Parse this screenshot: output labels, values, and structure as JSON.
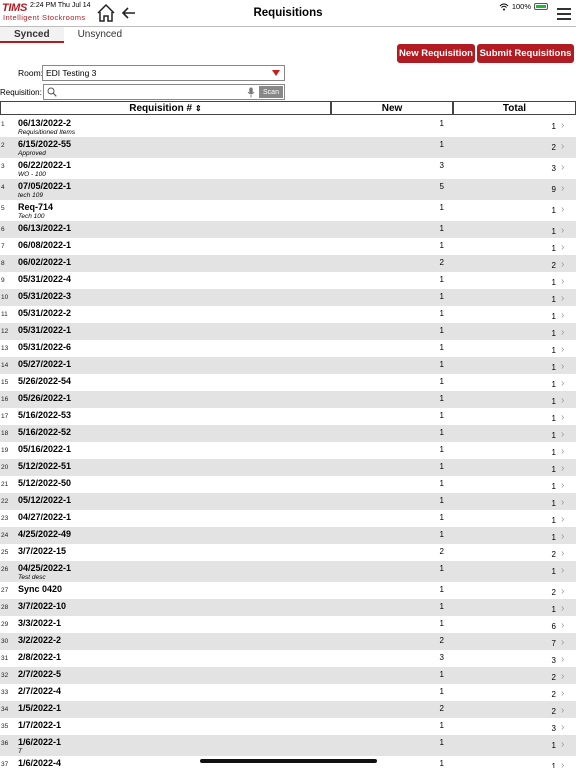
{
  "status": {
    "time": "2:24 PM  Thu Jul 14",
    "battery": "100%"
  },
  "logo": {
    "brand": "TIMS",
    "brand_alt": "AutoStock",
    "subtitle": "Intelligent Stockrooms"
  },
  "header": {
    "title": "Requisitions"
  },
  "tabs": [
    {
      "label": "Synced"
    },
    {
      "label": "Unsynced"
    }
  ],
  "actions": {
    "new_label": "New Requisition",
    "submit_label": "Submit Requisitions"
  },
  "room": {
    "label": "Room:",
    "value": "EDI Testing 3"
  },
  "requisition_search": {
    "label": "Requisition:",
    "placeholder": "",
    "scan_label": "Scan"
  },
  "table": {
    "headers": {
      "req": "Requisition #",
      "new": "New",
      "total": "Total"
    },
    "rows": [
      {
        "num": "1",
        "req": "06/13/2022-2",
        "desc": "Requisitioned Items",
        "new": "1",
        "total": "1"
      },
      {
        "num": "2",
        "req": "6/15/2022-55",
        "desc": "Approved",
        "new": "1",
        "total": "2"
      },
      {
        "num": "3",
        "req": "06/22/2022-1",
        "desc": "WO - 100",
        "new": "3",
        "total": "3"
      },
      {
        "num": "4",
        "req": "07/05/2022-1",
        "desc": "tech 109",
        "new": "5",
        "total": "9"
      },
      {
        "num": "5",
        "req": "Req-714",
        "desc": "Tech 100",
        "new": "1",
        "total": "1"
      },
      {
        "num": "6",
        "req": "06/13/2022-1",
        "desc": "",
        "new": "1",
        "total": "1"
      },
      {
        "num": "7",
        "req": "06/08/2022-1",
        "desc": "",
        "new": "1",
        "total": "1"
      },
      {
        "num": "8",
        "req": "06/02/2022-1",
        "desc": "",
        "new": "2",
        "total": "2"
      },
      {
        "num": "9",
        "req": "05/31/2022-4",
        "desc": "",
        "new": "1",
        "total": "1"
      },
      {
        "num": "10",
        "req": "05/31/2022-3",
        "desc": "",
        "new": "1",
        "total": "1"
      },
      {
        "num": "11",
        "req": "05/31/2022-2",
        "desc": "",
        "new": "1",
        "total": "1"
      },
      {
        "num": "12",
        "req": "05/31/2022-1",
        "desc": "",
        "new": "1",
        "total": "1"
      },
      {
        "num": "13",
        "req": "05/31/2022-6",
        "desc": "",
        "new": "1",
        "total": "1"
      },
      {
        "num": "14",
        "req": "05/27/2022-1",
        "desc": "",
        "new": "1",
        "total": "1"
      },
      {
        "num": "15",
        "req": "5/26/2022-54",
        "desc": "",
        "new": "1",
        "total": "1"
      },
      {
        "num": "16",
        "req": "05/26/2022-1",
        "desc": "",
        "new": "1",
        "total": "1"
      },
      {
        "num": "17",
        "req": "5/16/2022-53",
        "desc": "",
        "new": "1",
        "total": "1"
      },
      {
        "num": "18",
        "req": "5/16/2022-52",
        "desc": "",
        "new": "1",
        "total": "1"
      },
      {
        "num": "19",
        "req": "05/16/2022-1",
        "desc": "",
        "new": "1",
        "total": "1"
      },
      {
        "num": "20",
        "req": "5/12/2022-51",
        "desc": "",
        "new": "1",
        "total": "1"
      },
      {
        "num": "21",
        "req": "5/12/2022-50",
        "desc": "",
        "new": "1",
        "total": "1"
      },
      {
        "num": "22",
        "req": "05/12/2022-1",
        "desc": "",
        "new": "1",
        "total": "1"
      },
      {
        "num": "23",
        "req": "04/27/2022-1",
        "desc": "",
        "new": "1",
        "total": "1"
      },
      {
        "num": "24",
        "req": "4/25/2022-49",
        "desc": "",
        "new": "1",
        "total": "1"
      },
      {
        "num": "25",
        "req": "3/7/2022-15",
        "desc": "",
        "new": "2",
        "total": "2"
      },
      {
        "num": "26",
        "req": "04/25/2022-1",
        "desc": "Test desc",
        "new": "1",
        "total": "1"
      },
      {
        "num": "27",
        "req": "Sync 0420",
        "desc": "",
        "new": "1",
        "total": "2"
      },
      {
        "num": "28",
        "req": "3/7/2022-10",
        "desc": "",
        "new": "1",
        "total": "1"
      },
      {
        "num": "29",
        "req": "3/3/2022-1",
        "desc": "",
        "new": "1",
        "total": "6"
      },
      {
        "num": "30",
        "req": "3/2/2022-2",
        "desc": "",
        "new": "2",
        "total": "7"
      },
      {
        "num": "31",
        "req": "2/8/2022-1",
        "desc": "",
        "new": "3",
        "total": "3"
      },
      {
        "num": "32",
        "req": "2/7/2022-5",
        "desc": "",
        "new": "1",
        "total": "2"
      },
      {
        "num": "33",
        "req": "2/7/2022-4",
        "desc": "",
        "new": "1",
        "total": "2"
      },
      {
        "num": "34",
        "req": "1/5/2022-1",
        "desc": "",
        "new": "2",
        "total": "2"
      },
      {
        "num": "35",
        "req": "1/7/2022-1",
        "desc": "",
        "new": "1",
        "total": "3"
      },
      {
        "num": "36",
        "req": "1/6/2022-1",
        "desc": "T",
        "new": "1",
        "total": "1"
      },
      {
        "num": "37",
        "req": "1/6/2022-4",
        "desc": "",
        "new": "1",
        "total": "1"
      }
    ]
  },
  "colors": {
    "accent": "#b01c22",
    "row_shade": "#e3e3e3"
  },
  "icons": {
    "home": "home-icon",
    "back": "back-arrow-icon",
    "menu": "hamburger-menu-icon",
    "search": "search-icon",
    "mic": "microphone-icon",
    "chevron": "chevron-right-icon"
  }
}
